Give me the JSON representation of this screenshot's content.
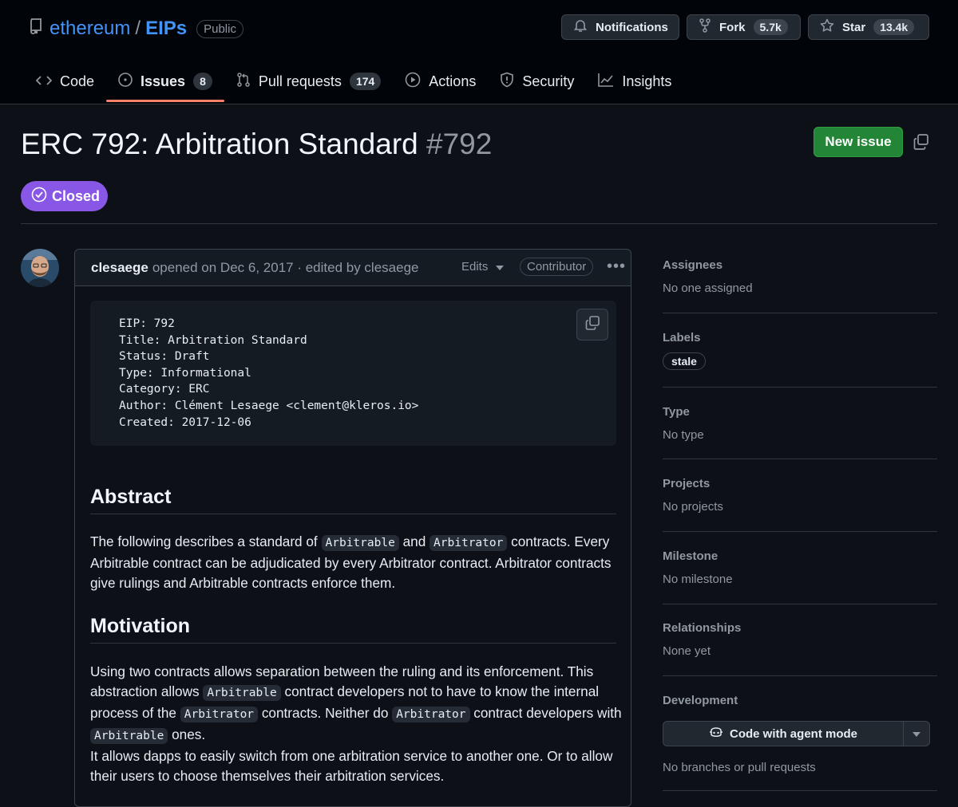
{
  "repo": {
    "owner": "ethereum",
    "separator": "/",
    "name": "EIPs",
    "visibility": "Public"
  },
  "header_buttons": {
    "notifications": "Notifications",
    "fork_label": "Fork",
    "fork_count": "5.7k",
    "star_label": "Star",
    "star_count": "13.4k"
  },
  "tabs": [
    {
      "label": "Code",
      "icon": "code-icon"
    },
    {
      "label": "Issues",
      "count": "8",
      "icon": "issue-icon"
    },
    {
      "label": "Pull requests",
      "count": "174",
      "icon": "pull-request-icon"
    },
    {
      "label": "Actions",
      "icon": "play-icon"
    },
    {
      "label": "Security",
      "icon": "shield-icon"
    },
    {
      "label": "Insights",
      "icon": "graph-icon"
    }
  ],
  "issue": {
    "title": "ERC 792: Arbitration Standard",
    "number": "#792",
    "state": "Closed",
    "new_issue_label": "New issue"
  },
  "comment": {
    "author": "clesaege",
    "meta": "opened on Dec 6, 2017 · edited by clesaege",
    "edits_label": "Edits",
    "role_badge": "Contributor",
    "code_lines": [
      "EIP: 792",
      "Title: Arbitration Standard",
      "Status: Draft",
      "Type: Informational",
      "Category: ERC",
      "Author: Clément Lesaege <clement@kleros.io>",
      "Created: 2017-12-06"
    ],
    "abstract_heading": "Abstract",
    "abstract": {
      "t1": "The following describes a standard of ",
      "c1": "Arbitrable",
      "t2": " and ",
      "c2": "Arbitrator",
      "t3": " contracts. Every Arbitrable contract can be adjudicated by every Arbitrator contract. Arbitrator contracts give rulings and Arbitrable contracts enforce them."
    },
    "motivation_heading": "Motivation",
    "motivation": {
      "t1": "Using two contracts allows separation between the ruling and its enforcement. This abstraction allows ",
      "c1": "Arbitrable",
      "t2": " contract developers not to have to know the internal process of the ",
      "c2": "Arbitrator",
      "t3": " contracts. Neither do ",
      "c3": "Arbitrator",
      "t4": " contract developers with ",
      "c4": "Arbitrable",
      "t5": " ones.",
      "p2": "It allows dapps to easily switch from one arbitration service to another one. Or to allow their users to choose themselves their arbitration services."
    }
  },
  "sidebar": {
    "assignees": {
      "heading": "Assignees",
      "value": "No one assigned"
    },
    "labels": {
      "heading": "Labels",
      "items": [
        "stale"
      ]
    },
    "type": {
      "heading": "Type",
      "value": "No type"
    },
    "projects": {
      "heading": "Projects",
      "value": "No projects"
    },
    "milestone": {
      "heading": "Milestone",
      "value": "No milestone"
    },
    "relationships": {
      "heading": "Relationships",
      "value": "None yet"
    },
    "development": {
      "heading": "Development",
      "button": "Code with agent mode",
      "value": "No branches or pull requests"
    }
  },
  "colors": {
    "accent_link": "#4493f8",
    "closed_badge": "#8957e5",
    "new_issue_button": "#238636",
    "active_tab_underline": "#f78166",
    "background": "#0d1117"
  }
}
